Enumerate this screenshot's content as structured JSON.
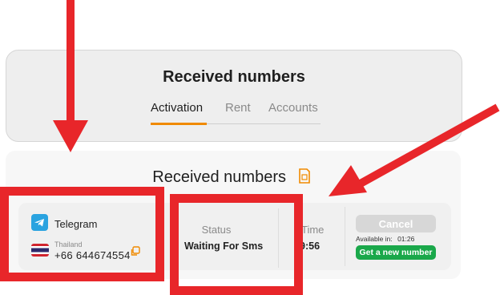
{
  "tabs_header": {
    "title": "Received numbers",
    "tabs": [
      {
        "label": "Activation",
        "active": true
      },
      {
        "label": "Rent",
        "active": false
      },
      {
        "label": "Accounts",
        "active": false
      }
    ]
  },
  "received": {
    "title": "Received numbers",
    "row": {
      "service": "Telegram",
      "service_icon": "telegram-icon",
      "country": "Thailand",
      "country_flag": "thailand-flag-icon",
      "phone": "+66 644674554",
      "status_label": "Status",
      "status_value": "Waiting For Sms",
      "time_label": "Time",
      "time_value": "9:56",
      "cancel_label": "Cancel",
      "available_label": "Available in:",
      "available_value": "01:26",
      "new_number_label": "Get a new number"
    }
  },
  "colors": {
    "accent": "#f08a00",
    "annotation_red": "#e8262a",
    "green_button": "#1aa84a",
    "telegram_blue": "#2aa3e0"
  }
}
